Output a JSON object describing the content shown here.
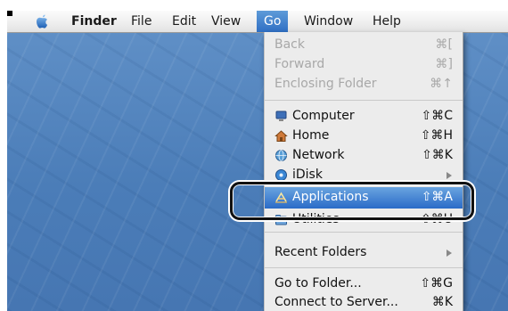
{
  "menubar": {
    "items": [
      {
        "label": "Finder"
      },
      {
        "label": "File"
      },
      {
        "label": "Edit"
      },
      {
        "label": "View"
      },
      {
        "label": "Go"
      },
      {
        "label": "Window"
      },
      {
        "label": "Help"
      }
    ],
    "active": "Go"
  },
  "go_menu": {
    "history": [
      {
        "label": "Back",
        "shortcut": "⌘[",
        "enabled": false
      },
      {
        "label": "Forward",
        "shortcut": "⌘]",
        "enabled": false
      },
      {
        "label": "Enclosing Folder",
        "shortcut": "⌘↑",
        "enabled": false
      }
    ],
    "places": [
      {
        "label": "Computer",
        "shortcut": "⇧⌘C",
        "icon": "computer-icon"
      },
      {
        "label": "Home",
        "shortcut": "⇧⌘H",
        "icon": "home-icon"
      },
      {
        "label": "Network",
        "shortcut": "⇧⌘K",
        "icon": "network-icon"
      },
      {
        "label": "iDisk",
        "shortcut": "",
        "icon": "idisk-icon",
        "submenu": true
      },
      {
        "label": "Applications",
        "shortcut": "⇧⌘A",
        "icon": "applications-icon",
        "highlighted": true
      },
      {
        "label": "Utilities",
        "shortcut": "⇧⌘U",
        "icon": "utilities-icon"
      }
    ],
    "recent": {
      "label": "Recent Folders",
      "submenu": true
    },
    "server": [
      {
        "label": "Go to Folder...",
        "shortcut": "⇧⌘G"
      },
      {
        "label": "Connect to Server...",
        "shortcut": "⌘K"
      }
    ]
  },
  "colors": {
    "highlight": "#2f6fc4",
    "desktop": "#4b7db8",
    "callout": "#111111"
  }
}
